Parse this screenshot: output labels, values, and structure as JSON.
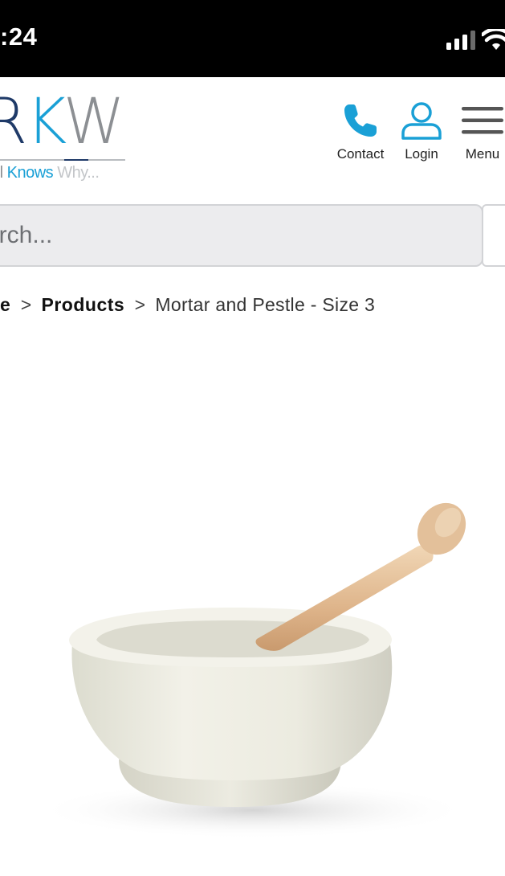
{
  "status_bar": {
    "time": ":24",
    "icons": [
      "signal-icon",
      "wifi-icon"
    ]
  },
  "header": {
    "logo": {
      "letters": [
        "R",
        "K",
        "W"
      ],
      "tagline_parts": [
        "tail ",
        "Knows",
        " Why..."
      ],
      "colors": {
        "navy": "#1f3a68",
        "cyan": "#1aa0d6",
        "grey": "#8c8f93"
      }
    },
    "nav": {
      "contact_label": "Contact",
      "login_label": "Login",
      "menu_label": "Menu"
    },
    "accent_color": "#1aa0d6"
  },
  "search": {
    "placeholder": "arch..."
  },
  "breadcrumb": {
    "home": "e",
    "separator": ">",
    "products": "Products",
    "current": "Mortar and Pestle - Size 3"
  },
  "product": {
    "image_icon": "mortar-and-pestle-image"
  }
}
